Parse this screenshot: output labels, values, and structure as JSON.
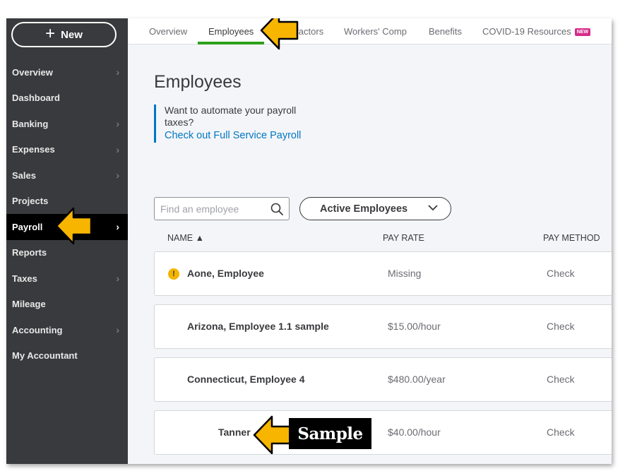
{
  "sidebar": {
    "new_label": "New",
    "items": [
      {
        "label": "Overview",
        "chevron": true
      },
      {
        "label": "Dashboard",
        "chevron": false
      },
      {
        "label": "Banking",
        "chevron": true
      },
      {
        "label": "Expenses",
        "chevron": true
      },
      {
        "label": "Sales",
        "chevron": true
      },
      {
        "label": "Projects",
        "chevron": false
      },
      {
        "label": "Payroll",
        "chevron": true,
        "active": true
      },
      {
        "label": "Reports",
        "chevron": false
      },
      {
        "label": "Taxes",
        "chevron": true
      },
      {
        "label": "Mileage",
        "chevron": false
      },
      {
        "label": "Accounting",
        "chevron": true
      },
      {
        "label": "My Accountant",
        "chevron": false
      }
    ]
  },
  "tabs": {
    "items": [
      "Overview",
      "Employees",
      "Contractors",
      "Workers' Comp",
      "Benefits",
      "COVID-19 Resources"
    ],
    "active": "Employees",
    "badge": "NEW"
  },
  "main": {
    "title": "Employees",
    "promo_text": "Want to automate your payroll taxes?",
    "promo_link": "Check out Full Service Payroll",
    "search_placeholder": "Find an employee",
    "filter_label": "Active Employees",
    "columns": {
      "name": "NAME ▲",
      "pay_rate": "PAY RATE",
      "pay_method": "PAY METHOD"
    },
    "rows": [
      {
        "name": "Aone, Employee",
        "pay_rate": "Missing",
        "pay_method": "Check",
        "warning": true
      },
      {
        "name": "Arizona, Employee 1.1 sample",
        "pay_rate": "$15.00/hour",
        "pay_method": "Check"
      },
      {
        "name": "Connecticut, Employee 4",
        "pay_rate": "$480.00/year",
        "pay_method": "Check"
      },
      {
        "name": "Tanner",
        "pay_rate": "$40.00/hour",
        "pay_method": "Check"
      }
    ]
  },
  "annotation": {
    "sample_label": "Sample"
  },
  "colors": {
    "sidebar": "#393a3d",
    "active_tab": "#2ca01c",
    "link": "#0077c5",
    "arrow": "#f7b500",
    "badge": "#d52b8a"
  }
}
